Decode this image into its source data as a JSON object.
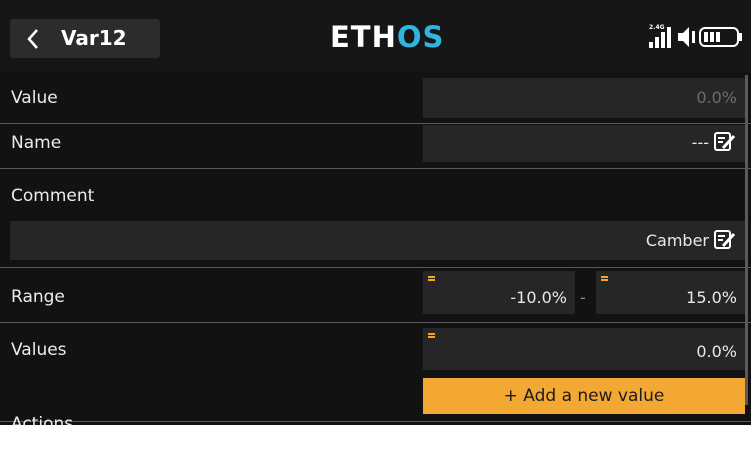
{
  "header": {
    "back_icon": "chevron-left-icon",
    "title": "Var12",
    "logo_prefix": "ETH",
    "logo_suffix": "OS",
    "logo_accent": "#2fb6e0",
    "band_label": "2.4G",
    "status_icons": [
      "signal-icon",
      "speaker-icon",
      "battery-icon"
    ]
  },
  "fields": {
    "value": {
      "label": "Value",
      "value": "0.0%"
    },
    "name": {
      "label": "Name",
      "value": "---",
      "icon": "edit-icon"
    },
    "comment": {
      "label": "Comment",
      "value": "Camber",
      "icon": "edit-icon"
    },
    "range": {
      "label": "Range",
      "min": "-10.0%",
      "separator": "-",
      "max": "15.0%"
    },
    "values": {
      "label": "Values",
      "value": "0.0%"
    }
  },
  "add_button": {
    "label": "+ Add a new value",
    "color": "#f3a834"
  },
  "actions": {
    "label": "Actions"
  }
}
